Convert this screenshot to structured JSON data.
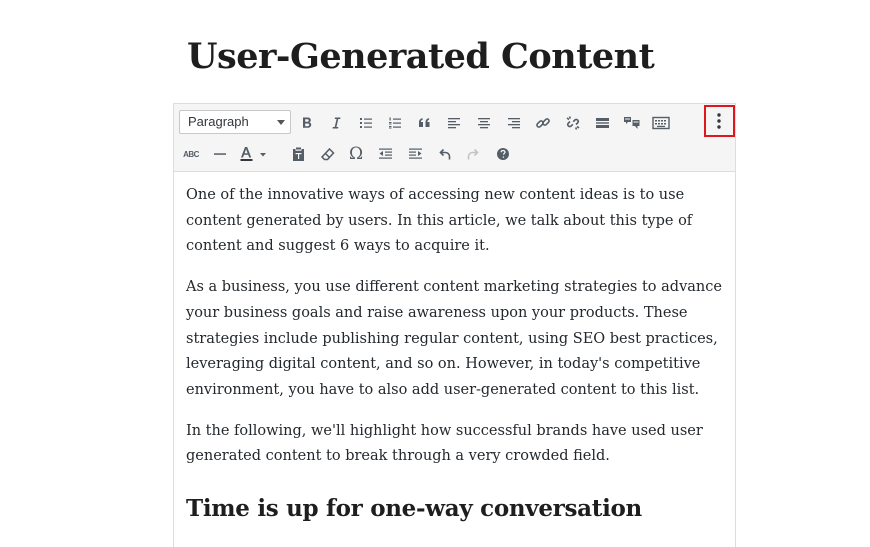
{
  "post": {
    "title": "User-Generated Content"
  },
  "toolbar": {
    "format_select": {
      "value": "Paragraph"
    },
    "row1": [
      {
        "name": "bold-button",
        "icon": "bold-icon"
      },
      {
        "name": "italic-button",
        "icon": "italic-icon"
      },
      {
        "name": "bulleted-list-button",
        "icon": "bulleted-list-icon"
      },
      {
        "name": "numbered-list-button",
        "icon": "numbered-list-icon"
      },
      {
        "name": "blockquote-button",
        "icon": "blockquote-icon"
      },
      {
        "name": "align-left-button",
        "icon": "align-left-icon"
      },
      {
        "name": "align-center-button",
        "icon": "align-center-icon"
      },
      {
        "name": "align-right-button",
        "icon": "align-right-icon"
      },
      {
        "name": "insert-link-button",
        "icon": "link-icon"
      },
      {
        "name": "remove-link-button",
        "icon": "unlink-icon"
      },
      {
        "name": "read-more-button",
        "icon": "read-more-icon"
      },
      {
        "name": "toolbar-toggle-button",
        "icon": "toolbar-toggle-icon"
      },
      {
        "name": "keyboard-shortcuts-button",
        "icon": "keyboard-icon"
      },
      {
        "name": "more-options-button",
        "icon": "vertical-ellipsis-icon"
      }
    ],
    "row2": {
      "spellcheck_label": "ABC",
      "omega_label": "Ω"
    },
    "highlight_color": "#e0161d"
  },
  "content": {
    "paragraphs": [
      "One of the innovative ways of accessing new content ideas is to use content generated by users. In this article, we talk about this type of content and suggest 6 ways to acquire it.",
      "As a business, you use different content marketing strategies to advance your business goals and raise awareness upon your products. These strategies include publishing regular content, using SEO best practices, leveraging digital content, and so on. However, in today's competitive environment, you have to also add user-generated content to this list.",
      "In the following, we'll highlight how successful brands have used user generated content to break through a very crowded field."
    ],
    "heading": "Time is up for one-way conversation"
  }
}
